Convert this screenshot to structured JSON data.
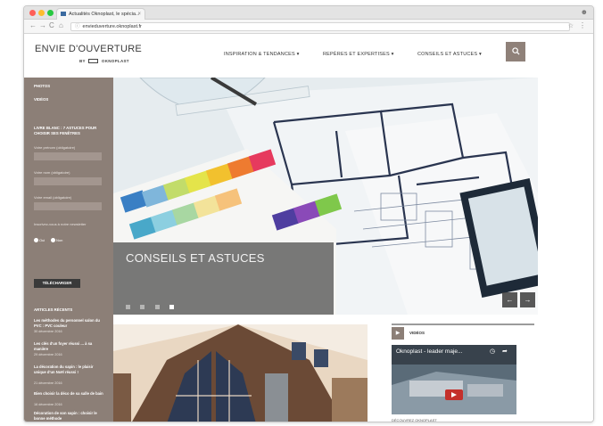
{
  "browser": {
    "tab_title": "Actualités Oknoplast, le spécia...",
    "tab_close": "×",
    "url": "envieduverture.oknoplast.fr",
    "nav_back": "←",
    "nav_forward": "→",
    "nav_reload": "C",
    "nav_home": "⌂"
  },
  "header": {
    "brand": "ENVIE D'OUVERTURE",
    "by": "BY",
    "by_company": "OKNOPLAST",
    "nav": [
      {
        "label": "INSPIRATION & TENDANCES ▾"
      },
      {
        "label": "REPÈRES ET EXPERTISES ▾"
      },
      {
        "label": "CONSEILS ET ASTUCES ▾"
      }
    ]
  },
  "sidebar": {
    "links": [
      "PHOTOS",
      "VIDÉOS"
    ],
    "form_title": "LIVRE BLANC : 7 ASTUCES POUR CHOISIR SES FENÊTRES",
    "fields": [
      {
        "label": "Votre prénom (obligatoire)"
      },
      {
        "label": "Votre nom (obligatoire)"
      },
      {
        "label": "Votre email (obligatoire)"
      }
    ],
    "newsletter_label": "Inscrivez-vous à notre newsletter",
    "radio_yes": "Oui",
    "radio_no": "Non",
    "download_button": "TÉLÉCHARGER",
    "recent_title": "ARTICLES RÉCENTS",
    "articles": [
      {
        "title": "Les méthodes du personnel salon du PVC : PVC couleur",
        "date": "30 décembre 2016"
      },
      {
        "title": "Les clés d'un foyer réussi ... à sa manière",
        "date": "29 décembre 2016"
      },
      {
        "title": "La décoration du sapin : le plaisir unique d'un Noël réussi !",
        "date": "21 décembre 2016"
      },
      {
        "title": "Bien choisir la déco de sa salle de bain",
        "date": "16 décembre 2016"
      },
      {
        "title": "Décoration de son sapin : choisir le bonne méthode",
        "date": "13 décembre 2016"
      }
    ]
  },
  "hero": {
    "caption": "CONSEILS ET ASTUCES",
    "slide_count": 4,
    "active_slide": 4,
    "prev": "←",
    "next": "→"
  },
  "videos": {
    "heading": "VIDÉOS",
    "video_title": "Oknoplast - leader maje...",
    "discover": "DÉCOUVREZ OKNOPLAST"
  },
  "colors": {
    "sidebar": "#8c7f77",
    "search_button": "#8f8179",
    "dark_button": "#3a3a3a"
  }
}
